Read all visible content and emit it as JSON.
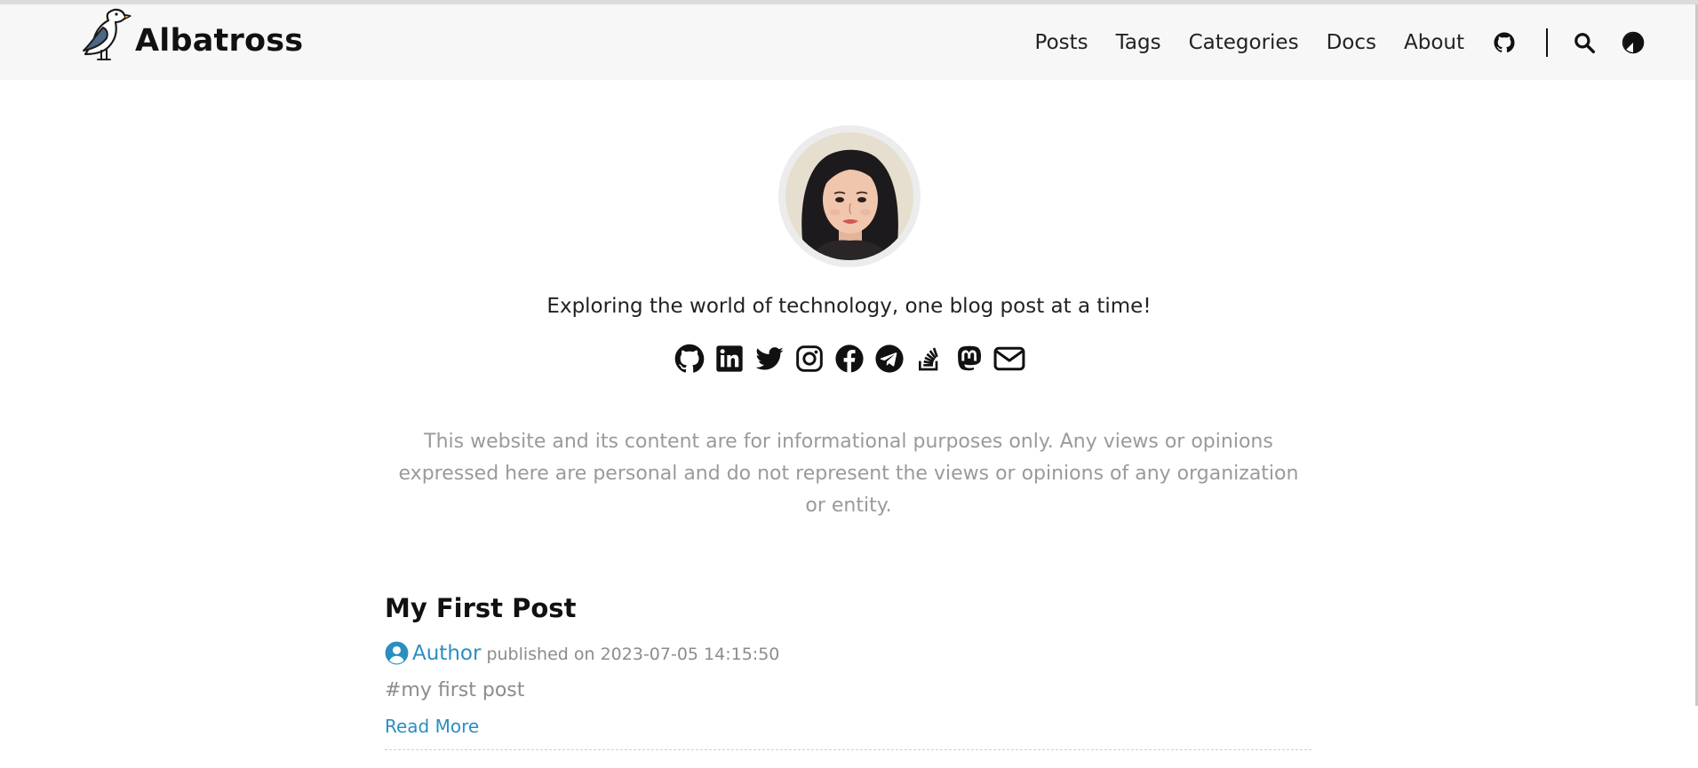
{
  "site": {
    "title": "Albatross",
    "logo": "albatross-bird-logo"
  },
  "nav": {
    "links": [
      "Posts",
      "Tags",
      "Categories",
      "Docs",
      "About"
    ],
    "icons": [
      "github-icon",
      "search-icon",
      "theme-toggle-icon"
    ]
  },
  "profile": {
    "avatar": "profile-avatar-woman",
    "tagline": "Exploring the world of technology, one blog post at a time!",
    "socials": [
      "github-icon",
      "linkedin-icon",
      "twitter-icon",
      "instagram-icon",
      "facebook-icon",
      "telegram-icon",
      "stackoverflow-icon",
      "mastodon-icon",
      "email-icon"
    ]
  },
  "disclaimer": "This website and its content are for informational purposes only. Any views or opinions expressed here are personal and do not represent the views or opinions of any organization or entity.",
  "posts": [
    {
      "title": "My First Post",
      "author": "Author",
      "published": "published on 2023-07-05 14:15:50",
      "tag": "#my first post",
      "read_more": "Read More"
    }
  ],
  "colors": {
    "accent": "#2a8fc0",
    "muted": "#9a9a9a",
    "navbar_bg": "#f7f7f7"
  }
}
